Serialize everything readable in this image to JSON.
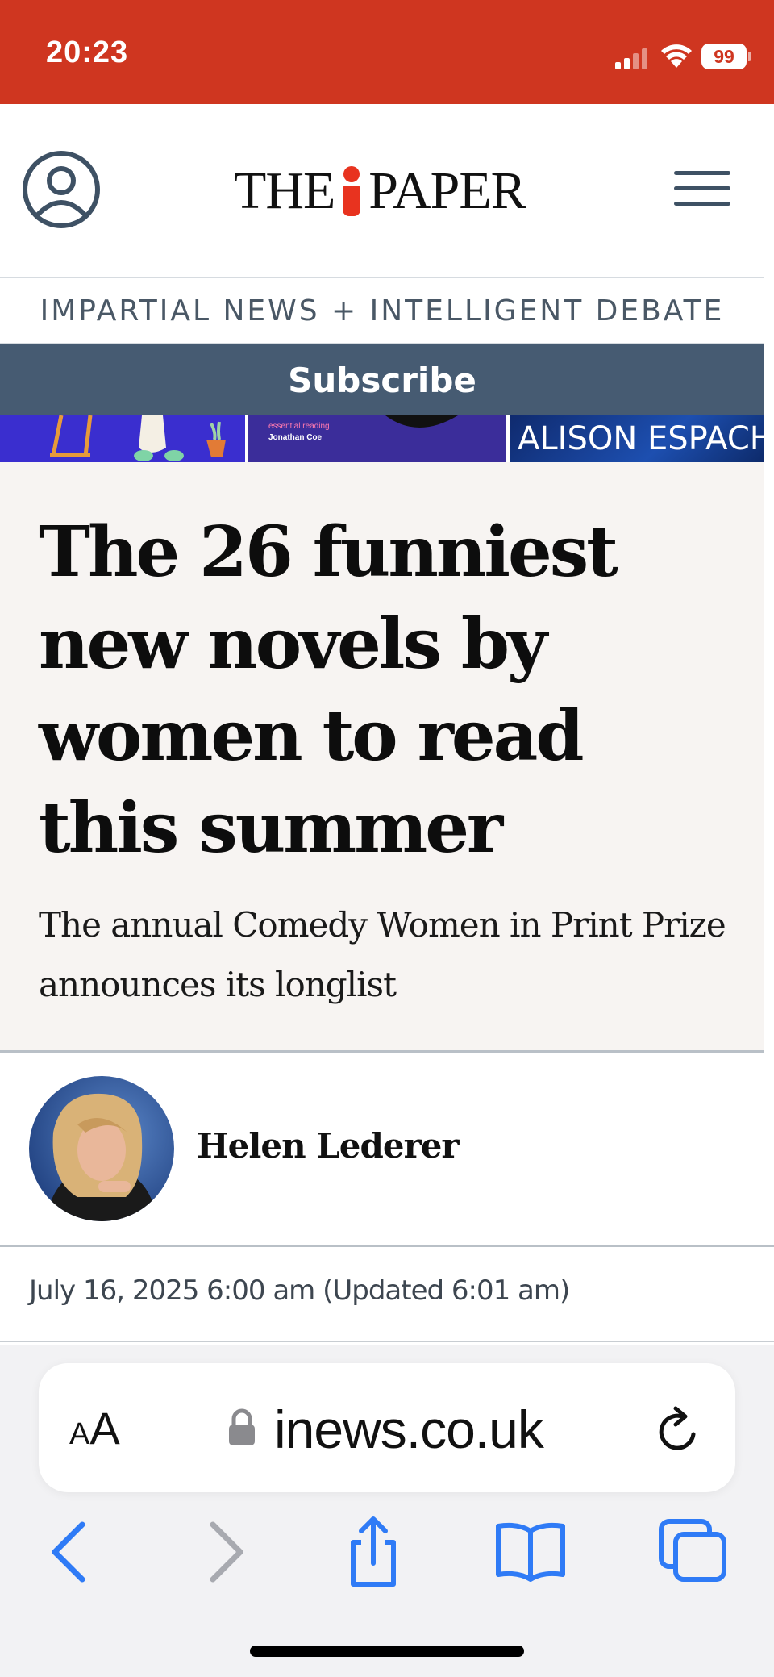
{
  "status_bar": {
    "time": "20:23",
    "battery": "99"
  },
  "header": {
    "logo_left": "THE",
    "logo_right": "PAPER",
    "tagline": "IMPARTIAL NEWS + INTELLIGENT DEBATE",
    "subscribe_label": "Subscribe",
    "accent_color": "#cf3620",
    "subscribe_color": "#465b72"
  },
  "strip": {
    "tile2_line1": "essential reading",
    "tile2_line2": "Jonathan Coe",
    "tile3_text": "ALISON ESPACH"
  },
  "article": {
    "headline": "The 26 funniest new novels by women to read this summer",
    "standfirst": "The annual Comedy Women in Print Prize announces its longlist",
    "author": "Helen Lederer",
    "dateline": "July 16, 2025 6:00 am (Updated 6:01 am)"
  },
  "browser": {
    "text_size_label_big": "A",
    "text_size_label_small": "A",
    "url": "inews.co.uk",
    "toolbar_icons": [
      "back-icon",
      "forward-icon",
      "share-icon",
      "bookmarks-icon",
      "tabs-icon"
    ]
  }
}
